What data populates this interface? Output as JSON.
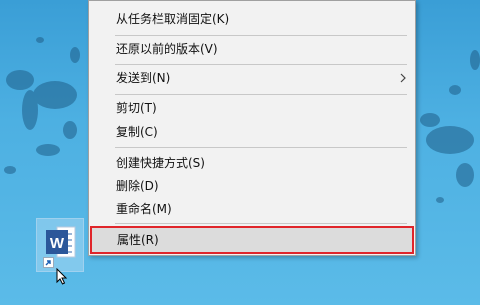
{
  "context_menu": {
    "items": [
      {
        "label": "从任务栏取消固定(K)"
      },
      {
        "label": "还原以前的版本(V)"
      },
      {
        "label": "发送到(N)",
        "has_submenu": true
      },
      {
        "label": "剪切(T)"
      },
      {
        "label": "复制(C)"
      },
      {
        "label": "创建快捷方式(S)"
      },
      {
        "label": "删除(D)"
      },
      {
        "label": "重命名(M)"
      },
      {
        "label": "属性(R)",
        "highlighted": true
      }
    ]
  },
  "desktop": {
    "icon": {
      "app": "word-icon",
      "letter": "W",
      "shortcut": true
    }
  },
  "colors": {
    "desktop_bg": "#4db0e2",
    "menu_bg": "#f2f2f2",
    "highlight_border": "#e0252a",
    "word_blue": "#2b579a"
  }
}
